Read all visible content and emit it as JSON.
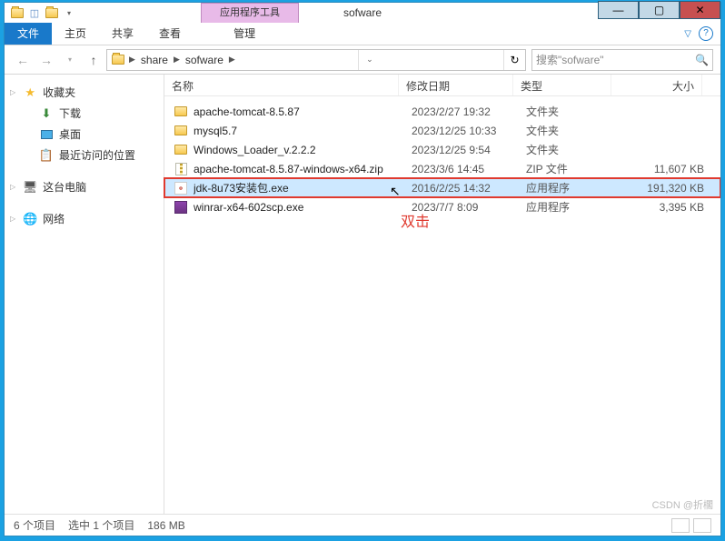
{
  "title": "sofware",
  "context_tab": "应用程序工具",
  "ribbon": {
    "file": "文件",
    "home": "主页",
    "share": "共享",
    "view": "查看",
    "manage": "管理"
  },
  "breadcrumb": [
    "share",
    "sofware"
  ],
  "search_placeholder": "搜索\"sofware\"",
  "sidebar": {
    "favorites": {
      "label": "收藏夹",
      "items": [
        "下载",
        "桌面",
        "最近访问的位置"
      ]
    },
    "computer": "这台电脑",
    "network": "网络"
  },
  "columns": {
    "name": "名称",
    "date": "修改日期",
    "type": "类型",
    "size": "大小"
  },
  "files": [
    {
      "name": "apache-tomcat-8.5.87",
      "date": "2023/2/27 19:32",
      "type": "文件夹",
      "size": "",
      "icon": "folder",
      "selected": false
    },
    {
      "name": "mysql5.7",
      "date": "2023/12/25 10:33",
      "type": "文件夹",
      "size": "",
      "icon": "folder",
      "selected": false
    },
    {
      "name": "Windows_Loader_v.2.2.2",
      "date": "2023/12/25 9:54",
      "type": "文件夹",
      "size": "",
      "icon": "folder",
      "selected": false
    },
    {
      "name": "apache-tomcat-8.5.87-windows-x64.zip",
      "date": "2023/3/6 14:45",
      "type": "ZIP 文件",
      "size": "11,607 KB",
      "icon": "zip",
      "selected": false
    },
    {
      "name": "jdk-8u73安装包.exe",
      "date": "2016/2/25 14:32",
      "type": "应用程序",
      "size": "191,320 KB",
      "icon": "exe",
      "selected": true
    },
    {
      "name": "winrar-x64-602scp.exe",
      "date": "2023/7/7 8:09",
      "type": "应用程序",
      "size": "3,395 KB",
      "icon": "rar",
      "selected": false
    }
  ],
  "annotation": "双击",
  "status": {
    "count": "6 个项目",
    "selected": "选中 1 个项目",
    "size": "186 MB"
  },
  "watermark": "CSDN @折櫊"
}
